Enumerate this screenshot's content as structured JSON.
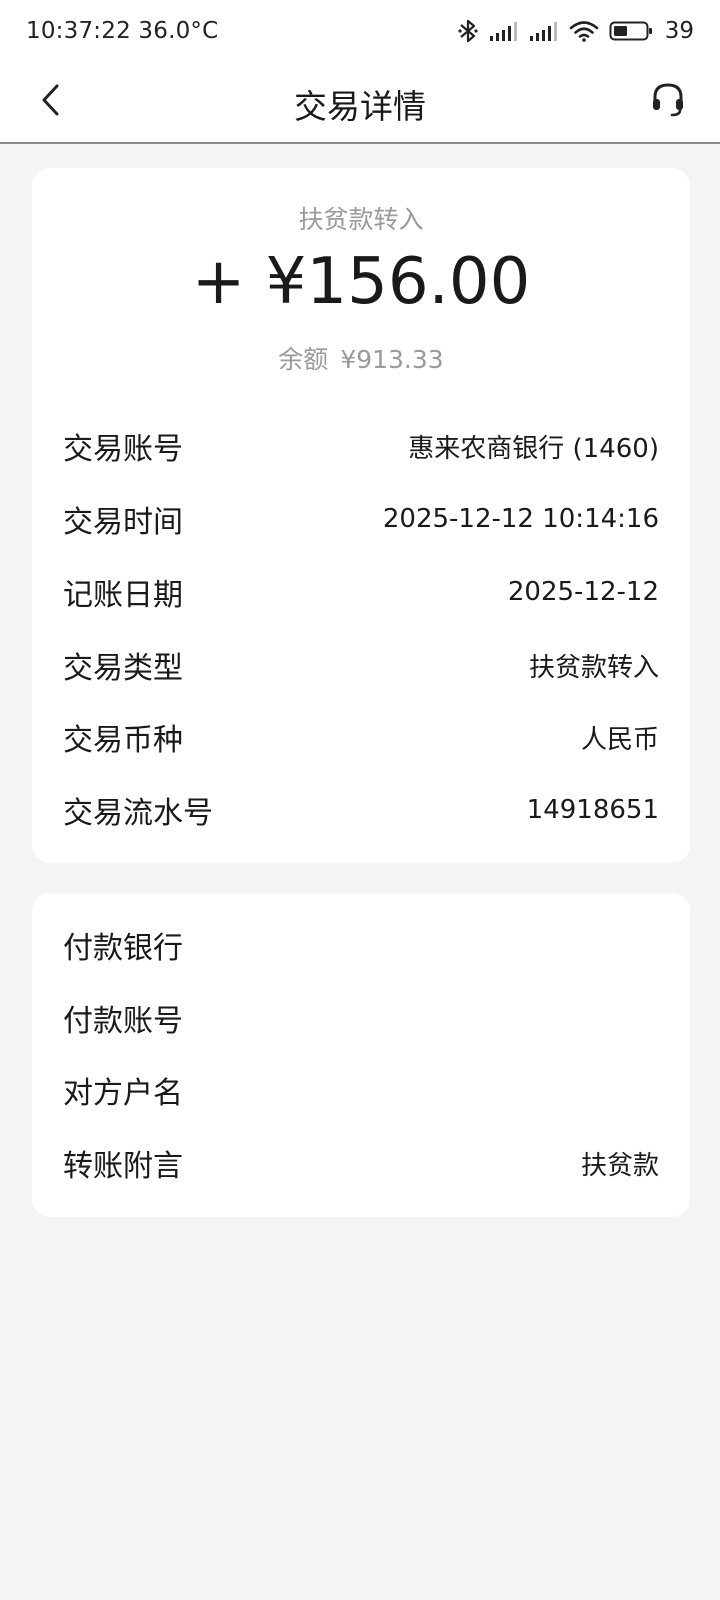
{
  "status_bar": {
    "time_temp": "10:37:22 36.0°C",
    "battery_level": "39",
    "icons": [
      "bluetooth-icon",
      "signal-icon",
      "signal-icon",
      "wifi-icon",
      "battery-icon"
    ]
  },
  "nav": {
    "title": "交易详情",
    "back_icon": "chevron-left-icon",
    "service_icon": "headset-icon"
  },
  "summary": {
    "type": "扶贫款转入",
    "amount": "+ ¥156.00",
    "balance_label": "余额",
    "balance_value": "¥913.33"
  },
  "details": [
    {
      "label": "交易账号",
      "value": "惠来农商银行 (1460)"
    },
    {
      "label": "交易时间",
      "value": "2025-12-12 10:14:16"
    },
    {
      "label": "记账日期",
      "value": "2025-12-12"
    },
    {
      "label": "交易类型",
      "value": "扶贫款转入"
    },
    {
      "label": "交易币种",
      "value": "人民币"
    },
    {
      "label": "交易流水号",
      "value": "14918651"
    }
  ],
  "counterparty": [
    {
      "label": "付款银行",
      "value": ""
    },
    {
      "label": "付款账号",
      "value": ""
    },
    {
      "label": "对方户名",
      "value": ""
    },
    {
      "label": "转账附言",
      "value": "扶贫款"
    }
  ]
}
